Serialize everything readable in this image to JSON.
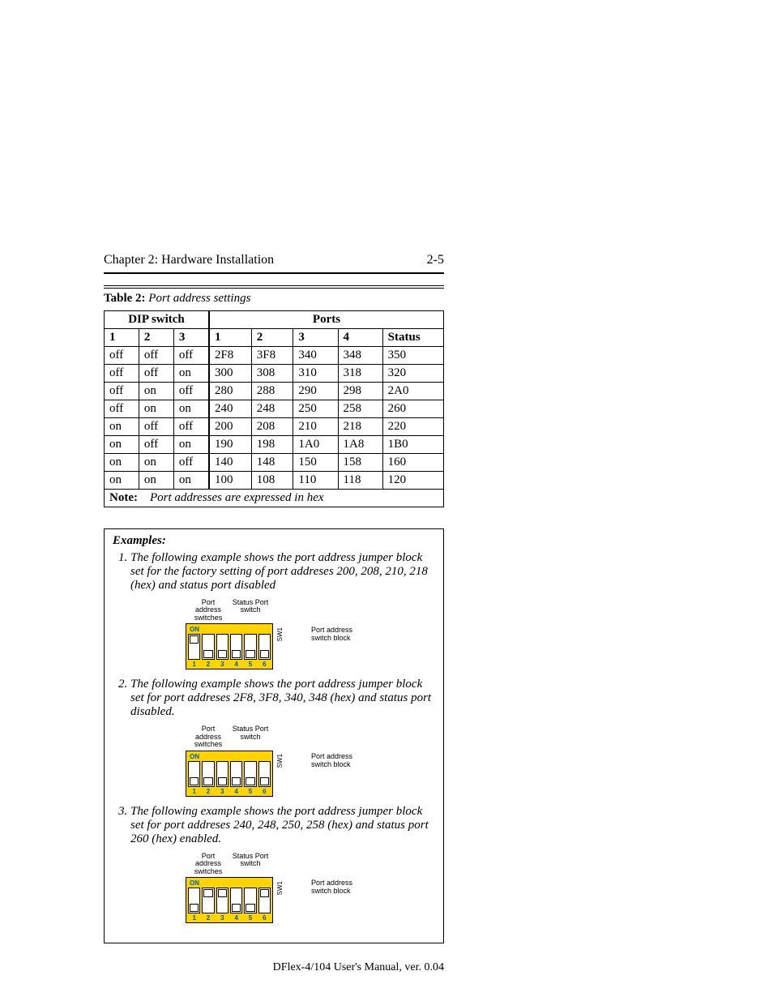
{
  "header": {
    "chapter": "Chapter 2: Hardware Installation",
    "page": "2-5"
  },
  "table": {
    "caption_label": "Table 2:",
    "caption_title": "Port address settings",
    "head_dip": "DIP switch",
    "head_ports": "Ports",
    "sub": [
      "1",
      "2",
      "3",
      "1",
      "2",
      "3",
      "4",
      "Status"
    ],
    "rows": [
      [
        "off",
        "off",
        "off",
        "2F8",
        "3F8",
        "340",
        "348",
        "350"
      ],
      [
        "off",
        "off",
        "on",
        "300",
        "308",
        "310",
        "318",
        "320"
      ],
      [
        "off",
        "on",
        "off",
        "280",
        "288",
        "290",
        "298",
        "2A0"
      ],
      [
        "off",
        "on",
        "on",
        "240",
        "248",
        "250",
        "258",
        "260"
      ],
      [
        "on",
        "off",
        "off",
        "200",
        "208",
        "210",
        "218",
        "220"
      ],
      [
        "on",
        "off",
        "on",
        "190",
        "198",
        "1A0",
        "1A8",
        "1B0"
      ],
      [
        "on",
        "on",
        "off",
        "140",
        "148",
        "150",
        "158",
        "160"
      ],
      [
        "on",
        "on",
        "on",
        "100",
        "108",
        "110",
        "118",
        "120"
      ]
    ],
    "note_label": "Note:",
    "note_text": "Port addresses are expressed in hex"
  },
  "examples": {
    "title": "Examples",
    "items": [
      {
        "text": "The following example shows the port address jumper block set for the factory setting of port addreses 200, 208, 210, 218 (hex) and status port disabled",
        "switches": [
          "up",
          "down",
          "down",
          "down",
          "down",
          "down"
        ]
      },
      {
        "text": "The following example shows the port address jumper block set for port addreses 2F8, 3F8, 340, 348 (hex) and status port disabled.",
        "switches": [
          "down",
          "down",
          "down",
          "down",
          "down",
          "down"
        ]
      },
      {
        "text": "The following example shows the port address jumper block set for port addreses 240, 248, 250, 258 (hex) and status port 260 (hex) enabled.",
        "switches": [
          "down",
          "up",
          "up",
          "down",
          "down",
          "up"
        ]
      }
    ],
    "fig_labels": {
      "port_addr": "Port address\nswitches",
      "status_port": "Status Port\nswitch",
      "on": "ON",
      "nums": [
        "1",
        "2",
        "3",
        "4",
        "5",
        "6"
      ],
      "sw1": "SW1",
      "side": "Port address\nswitch block"
    }
  },
  "footer": "DFlex-4/104 User's Manual, ver. 0.04",
  "chart_data": {
    "type": "table",
    "title": "Port address settings",
    "columns": [
      "DIP 1",
      "DIP 2",
      "DIP 3",
      "Port 1",
      "Port 2",
      "Port 3",
      "Port 4",
      "Status"
    ],
    "rows": [
      [
        "off",
        "off",
        "off",
        "2F8",
        "3F8",
        "340",
        "348",
        "350"
      ],
      [
        "off",
        "off",
        "on",
        "300",
        "308",
        "310",
        "318",
        "320"
      ],
      [
        "off",
        "on",
        "off",
        "280",
        "288",
        "290",
        "298",
        "2A0"
      ],
      [
        "off",
        "on",
        "on",
        "240",
        "248",
        "250",
        "258",
        "260"
      ],
      [
        "on",
        "off",
        "off",
        "200",
        "208",
        "210",
        "218",
        "220"
      ],
      [
        "on",
        "off",
        "on",
        "190",
        "198",
        "1A0",
        "1A8",
        "1B0"
      ],
      [
        "on",
        "on",
        "off",
        "140",
        "148",
        "150",
        "158",
        "160"
      ],
      [
        "on",
        "on",
        "on",
        "100",
        "108",
        "110",
        "118",
        "120"
      ]
    ],
    "note": "Port addresses are expressed in hex"
  }
}
